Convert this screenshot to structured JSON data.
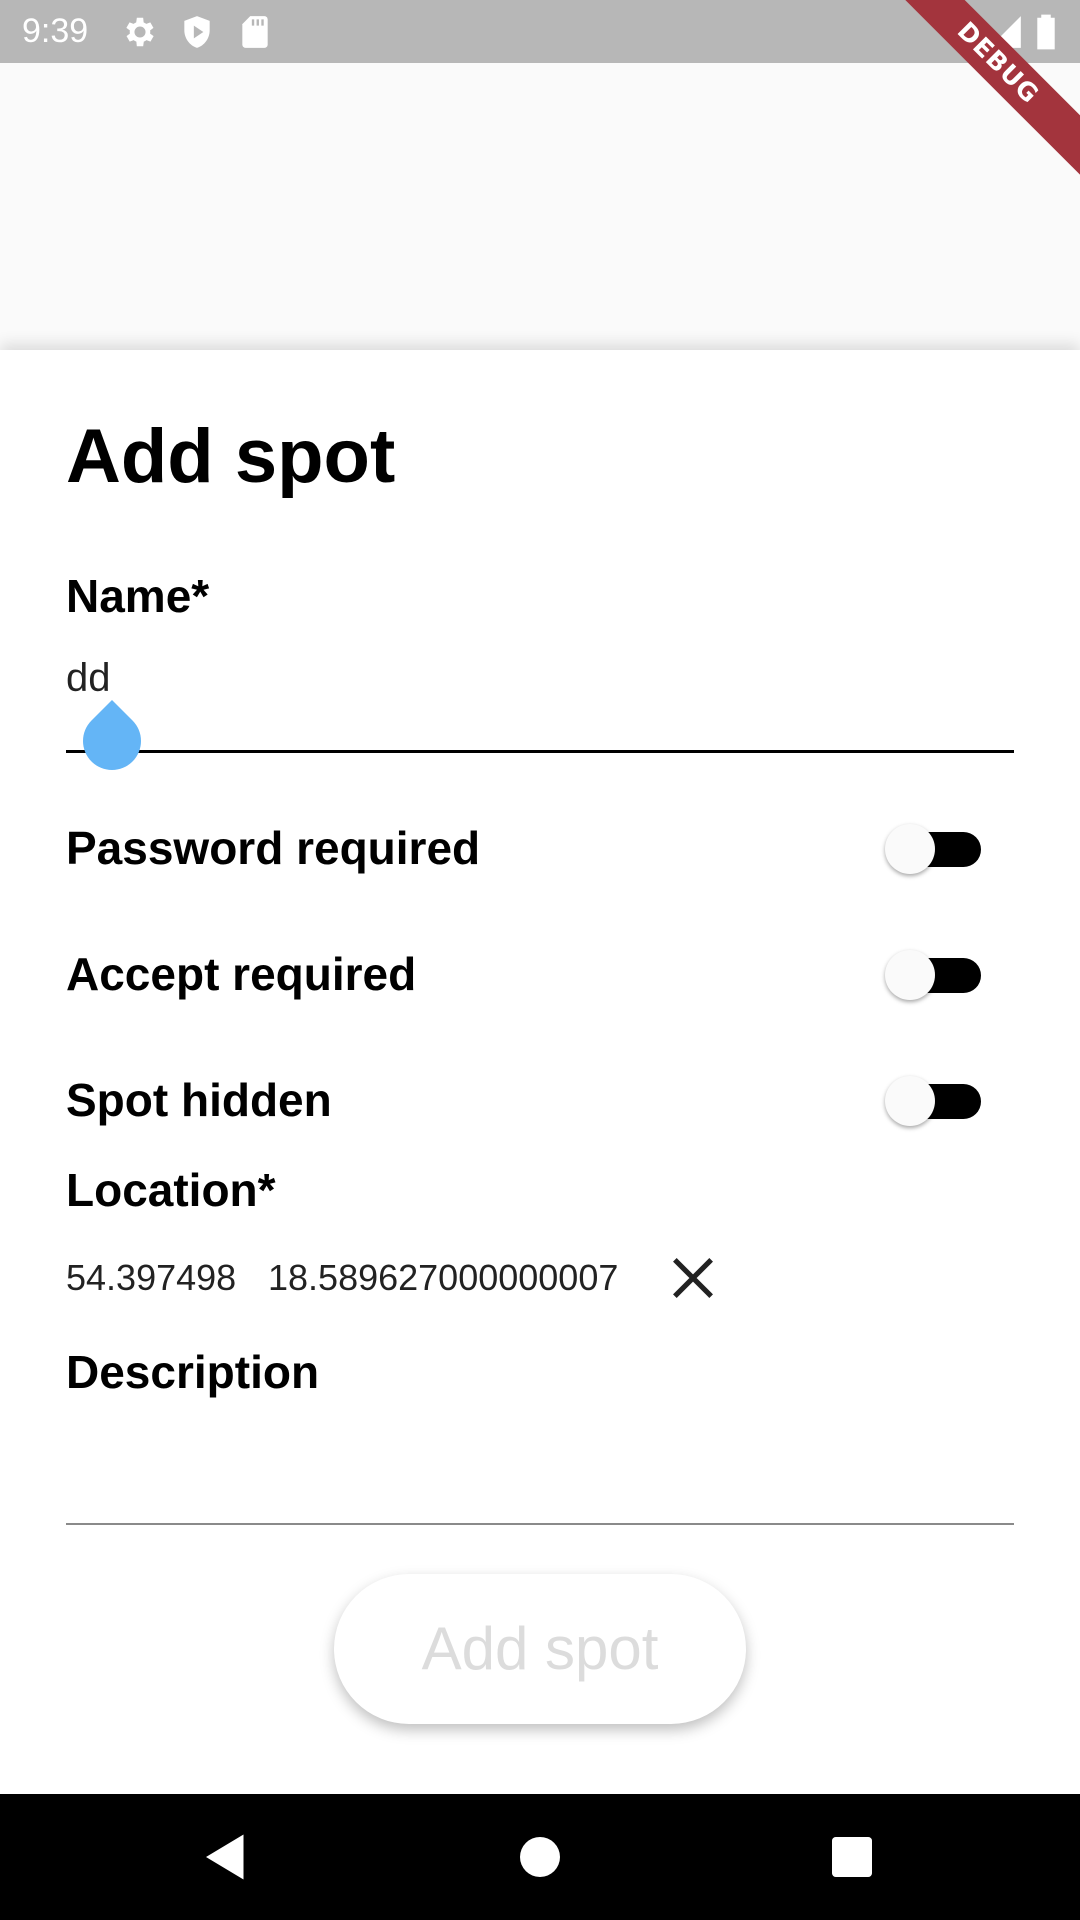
{
  "status_bar": {
    "time": "9:39",
    "icons": [
      "settings-icon",
      "shield-icon",
      "sd-card-icon",
      "wifi-icon",
      "signal-icon",
      "battery-icon"
    ],
    "debug_banner": "DEBUG"
  },
  "sheet": {
    "title": "Add spot",
    "name": {
      "label": "Name*",
      "value": "dd"
    },
    "switches": [
      {
        "label": "Password required",
        "on": false
      },
      {
        "label": "Accept required",
        "on": false
      },
      {
        "label": "Spot hidden",
        "on": false
      }
    ],
    "location": {
      "label": "Location*",
      "latitude": "54.397498",
      "longitude": "18.589627000000007",
      "clear_icon": "close-icon"
    },
    "description": {
      "label": "Description",
      "value": ""
    },
    "submit_label": "Add spot"
  },
  "nav_bar": {
    "buttons": [
      "back-icon",
      "home-icon",
      "recents-icon"
    ]
  },
  "colors": {
    "status_bar": "#b7b7b7",
    "debug_ribbon": "#a3343d",
    "cursor_handle": "#64b5f6",
    "switch_track": "#000000",
    "button_text_disabled": "#dcdcdc"
  }
}
